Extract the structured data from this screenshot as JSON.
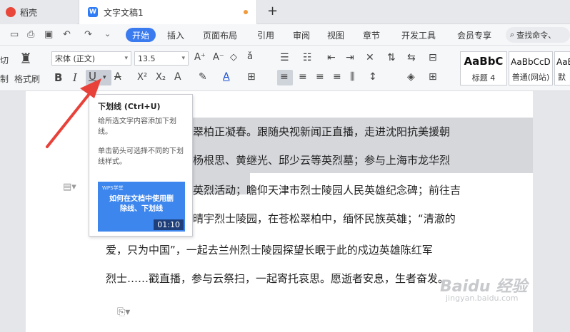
{
  "tabs": {
    "tab1": "稻壳",
    "tab2": "文字文稿1",
    "plus": "+"
  },
  "menu": {
    "start": "开始",
    "insert": "插入",
    "layout": "页面布局",
    "ref": "引用",
    "review": "审阅",
    "view": "视图",
    "section": "章节",
    "dev": "开发工具",
    "member": "会员专享",
    "search": "查找命令、"
  },
  "ribbon": {
    "clip_cut": "切",
    "clip_copy": "制",
    "format_painter": "格式刷",
    "font_name": "宋体 (正文)",
    "font_size": "13.5",
    "bold": "B",
    "italic": "I",
    "underline": "U",
    "superscript": "X²",
    "subscript": "X₂",
    "style1_preview": "AaBbC",
    "style1_name": "标题 4",
    "style2_preview": "AaBbCcD",
    "style2_name": "普通(网站)",
    "style3_preview": "AaE",
    "style3_name": "默"
  },
  "tooltip": {
    "title": "下划线 (Ctrl+U)",
    "desc": "给所选文字内容添加下划线。",
    "hint": "单击箭头可选择不同的下划线样式。",
    "video_logo": "WPS学堂",
    "video_title": "如何在文档中使用删除线、下划线",
    "video_time": "01:10"
  },
  "doc": {
    "lines": [
      "翠柏正凝春。跟随央视新闻正直播，走进沈阳抗美援朝",
      "杨根思、黄继光、邱少云等英烈墓；参与上海市龙华烈",
      "英烈活动；瞻仰天津市烈士陵园人民英雄纪念碑；前往吉",
      "晴宇烈士陵园，在苍松翠柏中，缅怀民族英雄；“清澈的",
      "爱，只为中国”，一起去兰州烈士陵园探望长眠于此的戍边英雄陈红军",
      "烈士……戳直播，参与云祭扫，一起寄托哀思。愿逝者安息，生者奋发。"
    ]
  },
  "watermark": {
    "brand": "Baidu 经验",
    "url": "jingyan.baidu.com"
  },
  "colors": {
    "accent": "#3a7bf0",
    "arrow": "#e8413a"
  }
}
